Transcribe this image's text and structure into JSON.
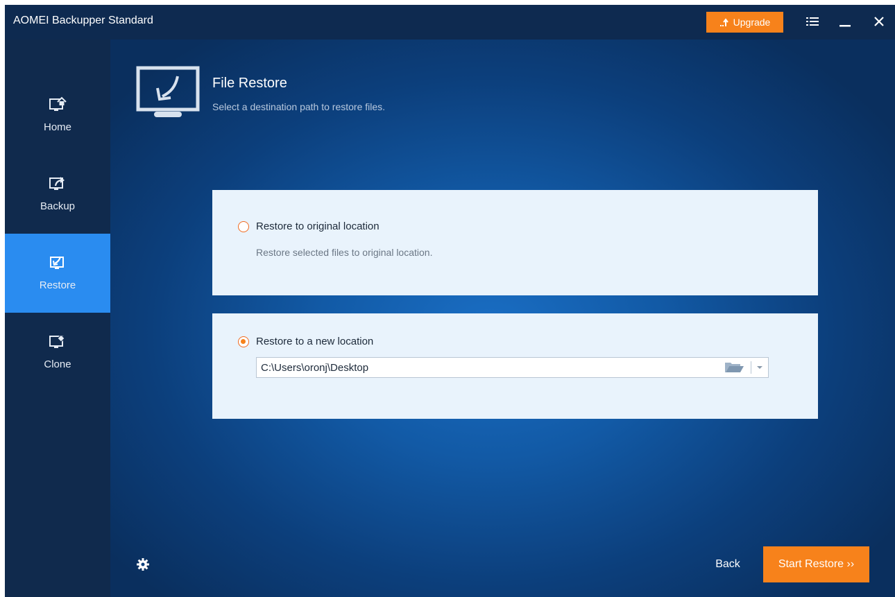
{
  "window": {
    "title": "AOMEI Backupper Standard",
    "upgrade_label": "Upgrade"
  },
  "sidebar": {
    "items": [
      {
        "label": "Home",
        "icon": "home-monitor-icon",
        "active": false
      },
      {
        "label": "Backup",
        "icon": "backup-monitor-icon",
        "active": false
      },
      {
        "label": "Restore",
        "icon": "restore-monitor-icon",
        "active": true
      },
      {
        "label": "Clone",
        "icon": "clone-monitor-icon",
        "active": false
      }
    ]
  },
  "main": {
    "title": "File Restore",
    "subtitle": "Select a destination path to restore files.",
    "options": {
      "original": {
        "label": "Restore to original location",
        "description": "Restore selected files to original location.",
        "selected": false
      },
      "new": {
        "label": "Restore to a new location",
        "selected": true,
        "path_value": "C:\\Users\\oronj\\Desktop"
      }
    }
  },
  "footer": {
    "back_label": "Back",
    "start_label": "Start Restore ››"
  },
  "colors": {
    "accent": "#f7821b",
    "active_nav": "#2a8cf0",
    "sidebar": "#102a4d",
    "titlebar": "#0e2a50",
    "card": "#e9f3fc"
  }
}
